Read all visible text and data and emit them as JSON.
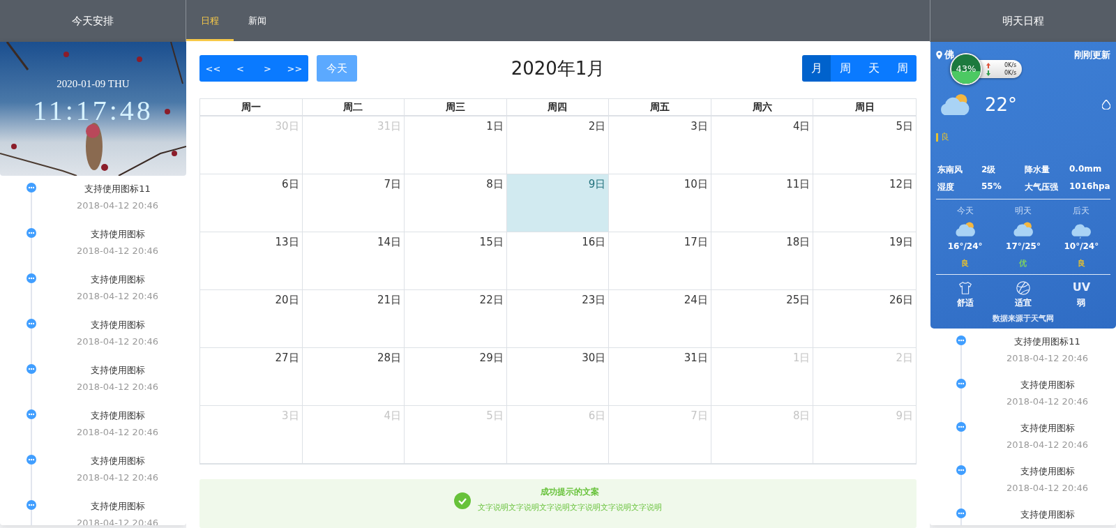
{
  "left_panel": {
    "title": "今天安排",
    "clock": {
      "date": "2020-01-09 THU",
      "time": "11:17:48"
    },
    "timeline": [
      {
        "title": "支持使用图标11",
        "time": "2018-04-12 20:46"
      },
      {
        "title": "支持使用图标",
        "time": "2018-04-12 20:46"
      },
      {
        "title": "支持使用图标",
        "time": "2018-04-12 20:46"
      },
      {
        "title": "支持使用图标",
        "time": "2018-04-12 20:46"
      },
      {
        "title": "支持使用图标",
        "time": "2018-04-12 20:46"
      },
      {
        "title": "支持使用图标",
        "time": "2018-04-12 20:46"
      },
      {
        "title": "支持使用图标",
        "time": "2018-04-12 20:46"
      },
      {
        "title": "支持使用图标",
        "time": "2018-04-12 20:46"
      }
    ]
  },
  "tabs": [
    {
      "label": "日程",
      "selected": true
    },
    {
      "label": "新闻",
      "selected": false
    }
  ],
  "calendar": {
    "nav_buttons": [
      "<<",
      "<",
      ">",
      ">>"
    ],
    "today_button": "今天",
    "title": "2020年1月",
    "views": [
      {
        "label": "月",
        "selected": true
      },
      {
        "label": "周",
        "selected": false
      },
      {
        "label": "天",
        "selected": false
      },
      {
        "label": "周",
        "selected": false
      }
    ],
    "weekdays": [
      "周一",
      "周二",
      "周三",
      "周四",
      "周五",
      "周六",
      "周日"
    ],
    "weeks": [
      [
        {
          "day": "30日",
          "other_month": true,
          "selected": false
        },
        {
          "day": "31日",
          "other_month": true,
          "selected": false
        },
        {
          "day": "1日",
          "other_month": false,
          "selected": false
        },
        {
          "day": "2日",
          "other_month": false,
          "selected": false
        },
        {
          "day": "3日",
          "other_month": false,
          "selected": false
        },
        {
          "day": "4日",
          "other_month": false,
          "selected": false
        },
        {
          "day": "5日",
          "other_month": false,
          "selected": false
        }
      ],
      [
        {
          "day": "6日",
          "other_month": false,
          "selected": false
        },
        {
          "day": "7日",
          "other_month": false,
          "selected": false
        },
        {
          "day": "8日",
          "other_month": false,
          "selected": false
        },
        {
          "day": "9日",
          "other_month": false,
          "selected": true
        },
        {
          "day": "10日",
          "other_month": false,
          "selected": false
        },
        {
          "day": "11日",
          "other_month": false,
          "selected": false
        },
        {
          "day": "12日",
          "other_month": false,
          "selected": false
        }
      ],
      [
        {
          "day": "13日",
          "other_month": false,
          "selected": false
        },
        {
          "day": "14日",
          "other_month": false,
          "selected": false
        },
        {
          "day": "15日",
          "other_month": false,
          "selected": false
        },
        {
          "day": "16日",
          "other_month": false,
          "selected": false
        },
        {
          "day": "17日",
          "other_month": false,
          "selected": false
        },
        {
          "day": "18日",
          "other_month": false,
          "selected": false
        },
        {
          "day": "19日",
          "other_month": false,
          "selected": false
        }
      ],
      [
        {
          "day": "20日",
          "other_month": false,
          "selected": false
        },
        {
          "day": "21日",
          "other_month": false,
          "selected": false
        },
        {
          "day": "22日",
          "other_month": false,
          "selected": false
        },
        {
          "day": "23日",
          "other_month": false,
          "selected": false
        },
        {
          "day": "24日",
          "other_month": false,
          "selected": false
        },
        {
          "day": "25日",
          "other_month": false,
          "selected": false
        },
        {
          "day": "26日",
          "other_month": false,
          "selected": false
        }
      ],
      [
        {
          "day": "27日",
          "other_month": false,
          "selected": false
        },
        {
          "day": "28日",
          "other_month": false,
          "selected": false
        },
        {
          "day": "29日",
          "other_month": false,
          "selected": false
        },
        {
          "day": "30日",
          "other_month": false,
          "selected": false
        },
        {
          "day": "31日",
          "other_month": false,
          "selected": false
        },
        {
          "day": "1日",
          "other_month": true,
          "selected": false
        },
        {
          "day": "2日",
          "other_month": true,
          "selected": false
        }
      ],
      [
        {
          "day": "3日",
          "other_month": true,
          "selected": false
        },
        {
          "day": "4日",
          "other_month": true,
          "selected": false
        },
        {
          "day": "5日",
          "other_month": true,
          "selected": false
        },
        {
          "day": "6日",
          "other_month": true,
          "selected": false
        },
        {
          "day": "7日",
          "other_month": true,
          "selected": false
        },
        {
          "day": "8日",
          "other_month": true,
          "selected": false
        },
        {
          "day": "9日",
          "other_month": true,
          "selected": false
        }
      ]
    ]
  },
  "alert": {
    "title": "成功提示的文案",
    "description": "文字说明文字说明文字说明文字说明文字说明文字说明"
  },
  "right_panel": {
    "title": "明天日程",
    "weather": {
      "city": "佛",
      "updated": "刚刚更新",
      "temperature": "22°",
      "air_quality": {
        "label": "良",
        "color": "#e6c130"
      },
      "network": {
        "reading": "43%",
        "level": 0.43,
        "upload": "0K/s",
        "download": "0K/s"
      },
      "details": [
        {
          "label": "东南风",
          "value": "2级"
        },
        {
          "label": "降水量",
          "value": "0.0mm"
        },
        {
          "label": "湿度",
          "value": "55%"
        },
        {
          "label": "大气压强",
          "value": "1016hpa"
        }
      ],
      "forecast": [
        {
          "day": "今天",
          "kind": "sun-cloud",
          "temperature": "16°/24°",
          "quality": "良",
          "color": "#e6c130"
        },
        {
          "day": "明天",
          "kind": "sun-cloud",
          "temperature": "17°/25°",
          "quality": "优",
          "color": "#7ed35f"
        },
        {
          "day": "后天",
          "kind": "rain",
          "temperature": "10°/24°",
          "quality": "良",
          "color": "#e6c130"
        }
      ],
      "indices": [
        {
          "kind": "shirt",
          "label": "舒适"
        },
        {
          "kind": "ball",
          "label": "适宜"
        },
        {
          "kind": "text",
          "symbol": "UV",
          "label": "弱"
        }
      ],
      "source": "数据来源于天气网"
    },
    "timeline": [
      {
        "title": "支持使用图标11",
        "time": "2018-04-12 20:46"
      },
      {
        "title": "支持使用图标",
        "time": "2018-04-12 20:46"
      },
      {
        "title": "支持使用图标",
        "time": "2018-04-12 20:46"
      },
      {
        "title": "支持使用图标",
        "time": "2018-04-12 20:46"
      },
      {
        "title": "支持使用图标"
      }
    ]
  }
}
